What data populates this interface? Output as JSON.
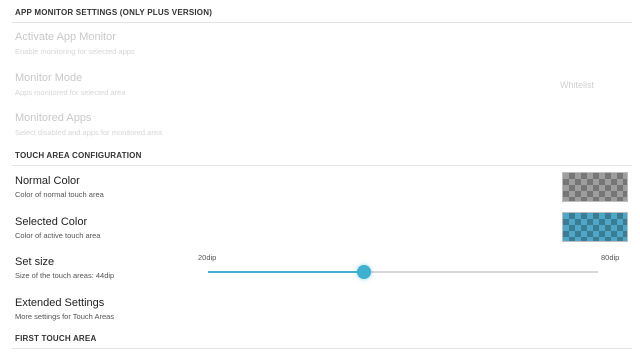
{
  "app_monitor": {
    "header": "APP MONITOR SETTINGS (ONLY PLUS VERSION)",
    "activate": {
      "title": "Activate App Monitor",
      "summary": "Enable monitoring for selected apps"
    },
    "mode": {
      "title": "Monitor Mode",
      "summary": "Apps monitored for selected area",
      "value": "Whitelist"
    },
    "detect": {
      "title": "Monitored Apps",
      "summary": "Select disabled and apps for monitored area"
    }
  },
  "touch_area": {
    "header": "TOUCH AREA CONFIGURATION",
    "normal_color": {
      "title": "Normal Color",
      "summary": "Color of normal touch area"
    },
    "selected_color": {
      "title": "Selected Color",
      "summary": "Color of active touch area"
    },
    "set_size": {
      "title": "Set size",
      "summary": "Size of the touch areas: 44dip",
      "min_label": "20dip",
      "max_label": "80dip",
      "min": 20,
      "max": 80,
      "value": 44
    },
    "extended": {
      "title": "Extended Settings",
      "summary": "More settings for Touch Areas"
    }
  },
  "first_touch": {
    "header": "FIRST TOUCH AREA"
  },
  "colors": {
    "accent": "#3fb0cf",
    "normal_swatch": "#9e9e9e",
    "selected_swatch": "#4fa6c7"
  }
}
